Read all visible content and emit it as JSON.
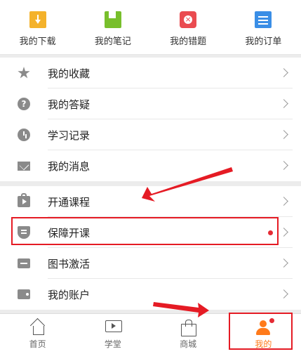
{
  "top_shortcuts": [
    {
      "label": "我的下载",
      "icon": "download-icon"
    },
    {
      "label": "我的笔记",
      "icon": "note-icon"
    },
    {
      "label": "我的错题",
      "icon": "wrong-question-icon"
    },
    {
      "label": "我的订单",
      "icon": "order-icon"
    }
  ],
  "menu_group_1": [
    {
      "label": "我的收藏",
      "icon": "star-icon"
    },
    {
      "label": "我的答疑",
      "icon": "question-icon"
    },
    {
      "label": "学习记录",
      "icon": "clock-icon"
    },
    {
      "label": "我的消息",
      "icon": "mail-icon"
    }
  ],
  "menu_group_2": [
    {
      "label": "开通课程",
      "icon": "course-bag-icon"
    },
    {
      "label": "保障开课",
      "icon": "shield-icon",
      "has_badge": true
    },
    {
      "label": "图书激活",
      "icon": "card-icon"
    },
    {
      "label": "我的账户",
      "icon": "wallet-icon"
    }
  ],
  "tabs": [
    {
      "label": "首页",
      "icon": "home-icon"
    },
    {
      "label": "学堂",
      "icon": "video-icon"
    },
    {
      "label": "商城",
      "icon": "shop-icon"
    },
    {
      "label": "我的",
      "icon": "profile-icon",
      "active": true
    }
  ],
  "colors": {
    "accent": "#ff7a1a",
    "annotation_red": "#e51b24",
    "badge_red": "#e52b34"
  }
}
